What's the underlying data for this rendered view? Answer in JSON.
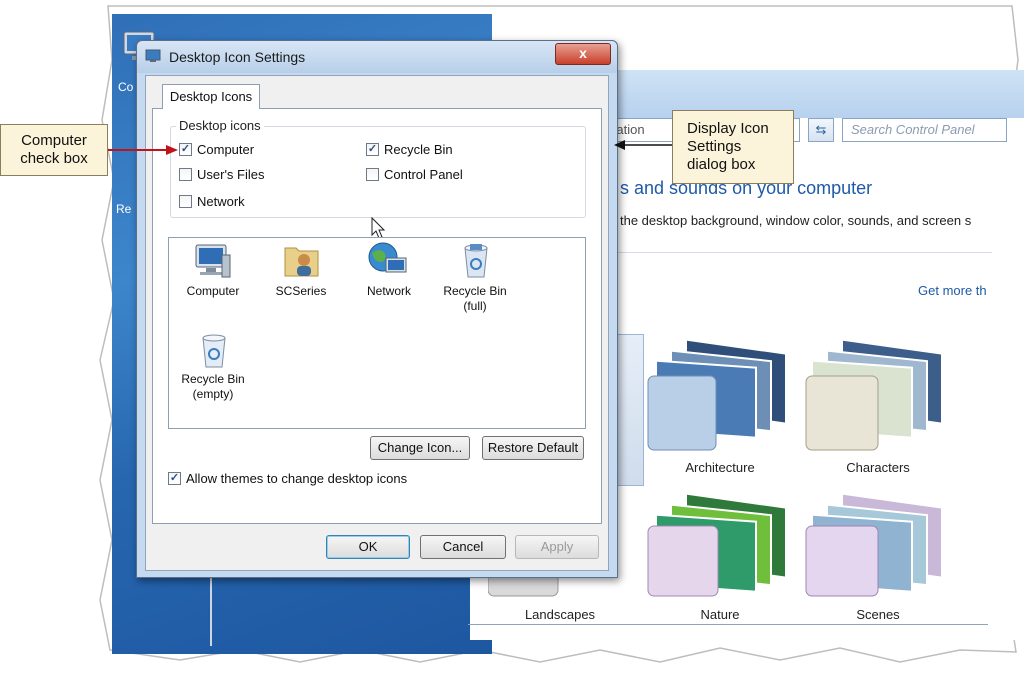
{
  "desktop": {
    "icon_label_1": "Co",
    "icon_label_2": "Re"
  },
  "control_panel": {
    "address_fragment": "ization",
    "search_placeholder": "Search Control Panel",
    "heading": "s and sounds on your computer",
    "subtitle": "the desktop background, window color, sounds, and screen s",
    "get_more_link": "Get more th",
    "themes": [
      "Architecture",
      "Characters",
      "Landscapes",
      "Nature",
      "Scenes"
    ]
  },
  "dialog": {
    "title": "Desktop Icon Settings",
    "close_glyph": "x",
    "tab_label": "Desktop Icons",
    "group_legend": "Desktop icons",
    "checkboxes": [
      {
        "label": "Computer",
        "checked": true
      },
      {
        "label": "Recycle Bin",
        "checked": true
      },
      {
        "label": "User's Files",
        "checked": false
      },
      {
        "label": "Control Panel",
        "checked": false
      },
      {
        "label": "Network",
        "checked": false
      }
    ],
    "icons": [
      {
        "label": "Computer",
        "icon": "computer-icon"
      },
      {
        "label": "SCSeries",
        "icon": "user-folder-icon"
      },
      {
        "label": "Network",
        "icon": "network-icon"
      },
      {
        "label_line1": "Recycle Bin",
        "label_line2": "(full)",
        "icon": "recycle-bin-full-icon"
      },
      {
        "label_line1": "Recycle Bin",
        "label_line2": "(empty)",
        "icon": "recycle-bin-empty-icon"
      }
    ],
    "change_icon_button": "Change Icon...",
    "restore_default_button": "Restore Default",
    "allow_themes_label": "Allow themes to change desktop icons",
    "allow_themes_checked": true,
    "ok_button": "OK",
    "cancel_button": "Cancel",
    "apply_button": "Apply"
  },
  "callouts": {
    "computer_check_box": [
      "Computer",
      "check box"
    ],
    "display_dialog": [
      "Display Icon",
      "Settings",
      "dialog box"
    ]
  },
  "colors": {
    "callout_fill": "#fbf4da",
    "arrow": "#c0141c",
    "link_blue": "#1e5aa8"
  }
}
